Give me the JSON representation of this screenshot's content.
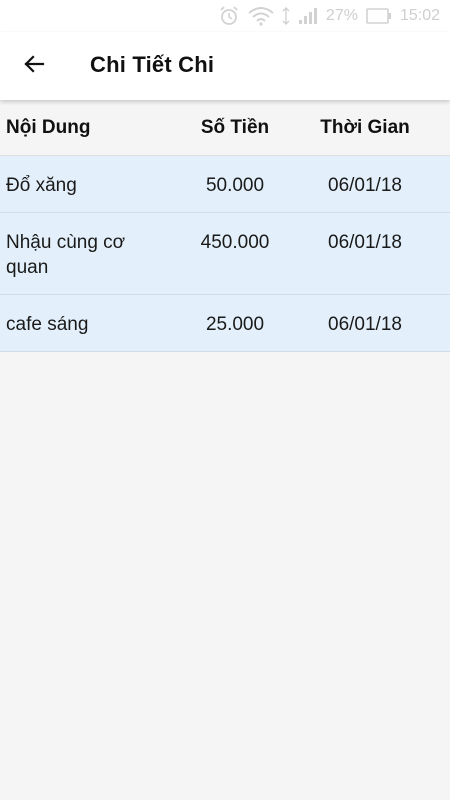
{
  "status_bar": {
    "battery_percent": "27%",
    "time": "15:02"
  },
  "app_bar": {
    "title": "Chi Tiết Chi"
  },
  "table": {
    "headers": [
      "Nội Dung",
      "Số Tiền",
      "Thời Gian"
    ],
    "rows": [
      {
        "content": "Đổ xăng",
        "amount": "50.000",
        "time": "06/01/18"
      },
      {
        "content": "Nhậu cùng cơ quan",
        "amount": "450.000",
        "time": "06/01/18"
      },
      {
        "content": "cafe sáng",
        "amount": "25.000",
        "time": "06/01/18"
      }
    ]
  },
  "colors": {
    "row_background": "#e3f0fb",
    "app_bar_background": "#ffffff",
    "page_background": "#f5f5f5"
  }
}
